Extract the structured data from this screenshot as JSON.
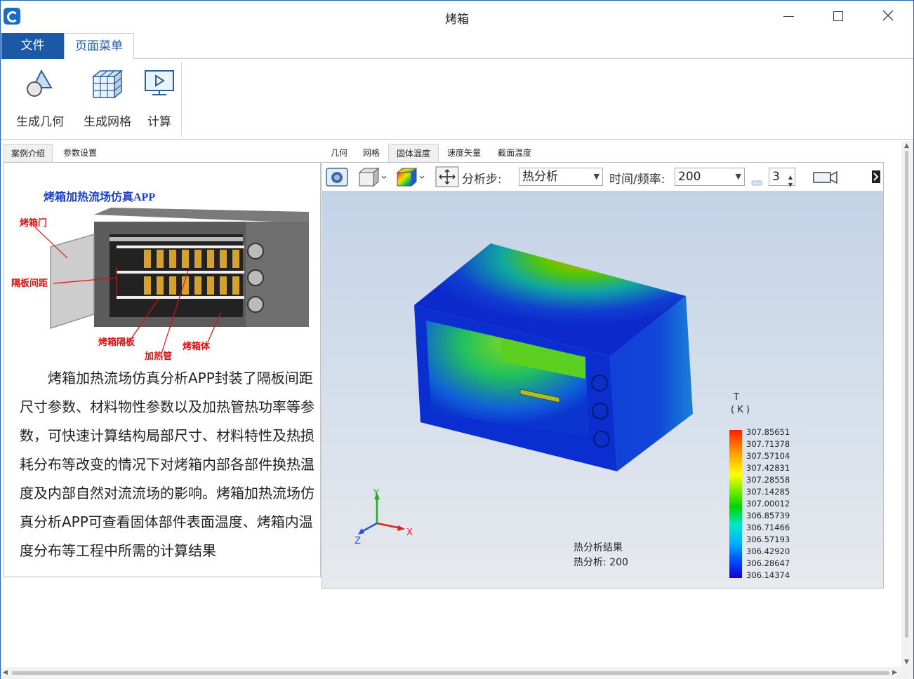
{
  "window": {
    "title": "烤箱"
  },
  "menu": {
    "file_label": "文件",
    "page_menu_label": "页面菜单"
  },
  "ribbon": {
    "buttons": [
      {
        "label": "生成几何",
        "icon": "geometry-icon"
      },
      {
        "label": "生成网格",
        "icon": "mesh-icon"
      },
      {
        "label": "计算",
        "icon": "compute-icon"
      }
    ]
  },
  "left": {
    "tabs": [
      "案例介绍",
      "参数设置"
    ],
    "diagram": {
      "title": "烤箱加热流场仿真APP",
      "callouts": [
        "烤箱门",
        "隔板间距",
        "烤箱隔板",
        "加热管",
        "烤箱体"
      ]
    },
    "intro": "烤箱加热流场仿真分析APP封装了隔板间距尺寸参数、材料物性参数以及加热管热功率等参数，可快速计算结构局部尺寸、材料特性及热损耗分布等改变的情况下对烤箱内部各部件换热温度及内部自然对流流场的影响。烤箱加热流场仿真分析APP可查看固体部件表面温度、烤箱内温度分布等工程中所需的计算结果"
  },
  "right": {
    "tabs": [
      "几何",
      "网格",
      "固体温度",
      "速度矢量",
      "截面温度"
    ],
    "active_tab": "固体温度",
    "toolbar": {
      "step_label": "分析步:",
      "step_value": "热分析",
      "time_label": "时间/频率:",
      "time_value": "200",
      "spin_value": "3"
    },
    "scene": {
      "result_title": "热分析结果",
      "result_step": "热分析: 200",
      "legend_title": "T",
      "legend_unit": "( K )",
      "legend_values": [
        "307.85651",
        "307.71378",
        "307.57104",
        "307.42831",
        "307.28558",
        "307.14285",
        "307.00012",
        "306.85739",
        "306.71466",
        "306.57193",
        "306.42920",
        "306.28647",
        "306.14374"
      ],
      "axes": [
        "Y",
        "X",
        "Z"
      ]
    }
  },
  "colors": {
    "accent": "#1d58a6",
    "viewport_top": "#c3d3e7",
    "viewport_bottom": "#e7e9ed"
  }
}
